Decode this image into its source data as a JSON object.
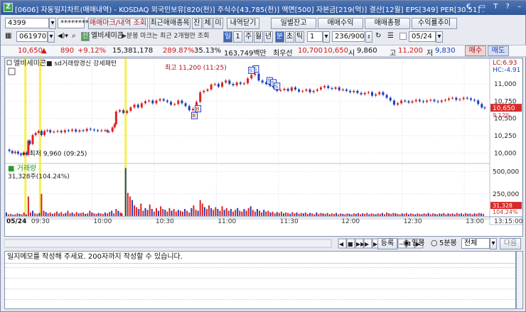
{
  "window": {
    "icon": "Z",
    "title": "[0606] 자동일지차트(매매내역) - KOSDAQ 외국인보유[820(천)] 주식수[43,785(천)] 액면[500] 자본금[219(억)] 결산[12월] EPS[349] PER[30.51] .",
    "controls": "€ ▭ T ? –"
  },
  "toolbar1": {
    "account": "4399",
    "password": "********",
    "buttons": [
      "매매마크/내역 조회",
      "최근매매종목",
      "잔",
      "체",
      "미",
      "내역닫기"
    ],
    "right_buttons": [
      "일별잔고",
      "매매수익",
      "매매총평",
      "수익률추이"
    ]
  },
  "toolbar2": {
    "code": "061970",
    "icon_label": "신",
    "stock_name": "엘비세미콘",
    "note": "▶분봉 마크는 최근 2개월만 조회",
    "period_tabs": [
      "일",
      "1",
      "주",
      "월",
      "년",
      "분",
      "초",
      "틱"
    ],
    "interval": "1",
    "count": "236/900",
    "date": "05/24"
  },
  "quote": {
    "price": "10,650",
    "change_arrow": "▲",
    "change": "890",
    "change_pct": "+9.12%",
    "volume": "15,381,178",
    "vol_ratio": "289.87%",
    "turnover": "35.13%",
    "amount": "163,749백만",
    "best_ask_label": "최우선",
    "best_ask": "10,700",
    "best_bid": "10,650",
    "open_label": "시",
    "open": "9,860",
    "high_label": "고",
    "high": "11,200",
    "low_label": "저",
    "low": "9,830",
    "buy_button": "매수",
    "sell_button": "매도"
  },
  "chart_data": {
    "type": "line",
    "legend": [
      "엘비세미콘",
      "sd거래량경신 강세패턴"
    ],
    "max_annotation": "최고 11,200 (11:25)",
    "min_annotation": "최저 9,960 (09:25)",
    "price_axis": [
      "11,000",
      "10,750",
      "10,500",
      "10,250",
      "10,000"
    ],
    "price_ylim": [
      9870,
      11330
    ],
    "hc_lc": [
      "LC:6.93",
      "HC:-4.91"
    ],
    "current_label": "10,650",
    "current_pct": "9.12%",
    "volume_label": "거래량",
    "volume_value": "31,328주(104.24%)",
    "volume_axis": [
      "500,000",
      "250,000"
    ],
    "volume_ylim": [
      0,
      560000
    ],
    "volume_current": "31,328",
    "volume_current_pct": "104.24%",
    "x_labels": [
      "05/24",
      "09:30",
      "10:00",
      "10:30",
      "11:00",
      "11:30",
      "12:00",
      "12:30",
      "13:00",
      "13:15:00"
    ],
    "price_series": [
      [
        0,
        10050
      ],
      [
        4,
        10030
      ],
      [
        8,
        10000
      ],
      [
        12,
        10020
      ],
      [
        16,
        9990
      ],
      [
        20,
        9970
      ],
      [
        24,
        10010
      ],
      [
        28,
        9975
      ],
      [
        30,
        10180
      ],
      [
        32,
        10130
      ],
      [
        36,
        10260
      ],
      [
        40,
        10290
      ],
      [
        44,
        10320
      ],
      [
        48,
        10260
      ],
      [
        52,
        10320
      ],
      [
        56,
        10330
      ],
      [
        60,
        10300
      ],
      [
        65,
        10310
      ],
      [
        70,
        10320
      ],
      [
        75,
        10300
      ],
      [
        80,
        10330
      ],
      [
        85,
        10320
      ],
      [
        90,
        10340
      ],
      [
        95,
        10310
      ],
      [
        100,
        10330
      ],
      [
        105,
        10320
      ],
      [
        110,
        10350
      ],
      [
        115,
        10340
      ],
      [
        120,
        10330
      ],
      [
        125,
        10320
      ],
      [
        130,
        10330
      ],
      [
        135,
        10330
      ],
      [
        138,
        10310
      ],
      [
        140,
        10310
      ],
      [
        145,
        10370
      ],
      [
        148,
        10420
      ],
      [
        150,
        10600
      ],
      [
        155,
        10620
      ],
      [
        160,
        10580
      ],
      [
        165,
        10610
      ],
      [
        170,
        10660
      ],
      [
        175,
        10700
      ],
      [
        180,
        10660
      ],
      [
        185,
        10720
      ],
      [
        190,
        10750
      ],
      [
        195,
        10760
      ],
      [
        200,
        10720
      ],
      [
        205,
        10760
      ],
      [
        210,
        10780
      ],
      [
        215,
        10760
      ],
      [
        220,
        10740
      ],
      [
        225,
        10700
      ],
      [
        230,
        10710
      ],
      [
        235,
        10760
      ],
      [
        240,
        10720
      ],
      [
        245,
        10680
      ],
      [
        250,
        10620
      ],
      [
        255,
        10640
      ],
      [
        260,
        10740
      ],
      [
        265,
        10880
      ],
      [
        270,
        10900
      ],
      [
        275,
        10920
      ],
      [
        280,
        10990
      ],
      [
        285,
        11000
      ],
      [
        290,
        10960
      ],
      [
        295,
        11020
      ],
      [
        300,
        11050
      ],
      [
        305,
        11000
      ],
      [
        310,
        10980
      ],
      [
        315,
        11020
      ],
      [
        320,
        11000
      ],
      [
        325,
        11010
      ],
      [
        330,
        11080
      ],
      [
        335,
        11130
      ],
      [
        340,
        11150
      ],
      [
        345,
        11050
      ],
      [
        350,
        11020
      ],
      [
        355,
        11000
      ],
      [
        360,
        10980
      ],
      [
        365,
        10950
      ],
      [
        370,
        10900
      ],
      [
        375,
        10910
      ],
      [
        380,
        10930
      ],
      [
        385,
        10900
      ],
      [
        390,
        10950
      ],
      [
        395,
        10920
      ],
      [
        400,
        10890
      ],
      [
        405,
        10900
      ],
      [
        410,
        10920
      ],
      [
        415,
        10880
      ],
      [
        420,
        10900
      ],
      [
        425,
        10920
      ],
      [
        430,
        10950
      ],
      [
        435,
        10970
      ],
      [
        440,
        10940
      ],
      [
        445,
        10930
      ],
      [
        450,
        10950
      ],
      [
        455,
        10910
      ],
      [
        460,
        10920
      ],
      [
        465,
        10900
      ],
      [
        470,
        10880
      ],
      [
        475,
        10900
      ],
      [
        480,
        10870
      ],
      [
        485,
        10850
      ],
      [
        490,
        10870
      ],
      [
        495,
        10880
      ],
      [
        500,
        10830
      ],
      [
        505,
        10850
      ],
      [
        510,
        10880
      ],
      [
        515,
        10840
      ],
      [
        520,
        10800
      ],
      [
        525,
        10760
      ],
      [
        530,
        10700
      ],
      [
        535,
        10720
      ],
      [
        540,
        10760
      ],
      [
        545,
        10750
      ],
      [
        550,
        10730
      ],
      [
        555,
        10750
      ],
      [
        560,
        10770
      ],
      [
        565,
        10750
      ],
      [
        570,
        10740
      ],
      [
        575,
        10760
      ],
      [
        580,
        10770
      ],
      [
        585,
        10750
      ],
      [
        590,
        10740
      ],
      [
        595,
        10760
      ],
      [
        600,
        10770
      ],
      [
        605,
        10790
      ],
      [
        610,
        10800
      ],
      [
        615,
        10770
      ],
      [
        620,
        10780
      ],
      [
        625,
        10800
      ],
      [
        630,
        10790
      ],
      [
        635,
        10770
      ],
      [
        640,
        10760
      ],
      [
        645,
        10710
      ],
      [
        650,
        10660
      ],
      [
        654,
        10650
      ]
    ],
    "volume_series": [
      [
        0,
        40000
      ],
      [
        3,
        20000
      ],
      [
        6,
        25000
      ],
      [
        9,
        15000
      ],
      [
        12,
        20000
      ],
      [
        15,
        30000
      ],
      [
        18,
        25000
      ],
      [
        21,
        20000
      ],
      [
        24,
        40000
      ],
      [
        27,
        20000
      ],
      [
        30,
        220000
      ],
      [
        33,
        40000
      ],
      [
        36,
        60000
      ],
      [
        39,
        30000
      ],
      [
        42,
        25000
      ],
      [
        45,
        35000
      ],
      [
        48,
        250000
      ],
      [
        51,
        60000
      ],
      [
        54,
        45000
      ],
      [
        57,
        30000
      ],
      [
        60,
        40000
      ],
      [
        63,
        25000
      ],
      [
        66,
        35000
      ],
      [
        69,
        50000
      ],
      [
        72,
        30000
      ],
      [
        75,
        45000
      ],
      [
        78,
        25000
      ],
      [
        81,
        35000
      ],
      [
        84,
        60000
      ],
      [
        87,
        30000
      ],
      [
        90,
        40000
      ],
      [
        93,
        25000
      ],
      [
        96,
        45000
      ],
      [
        99,
        30000
      ],
      [
        102,
        35000
      ],
      [
        105,
        40000
      ],
      [
        108,
        25000
      ],
      [
        111,
        30000
      ],
      [
        114,
        60000
      ],
      [
        117,
        40000
      ],
      [
        120,
        30000
      ],
      [
        123,
        25000
      ],
      [
        126,
        35000
      ],
      [
        129,
        30000
      ],
      [
        132,
        25000
      ],
      [
        135,
        40000
      ],
      [
        138,
        30000
      ],
      [
        141,
        45000
      ],
      [
        144,
        60000
      ],
      [
        147,
        30000
      ],
      [
        150,
        80000
      ],
      [
        153,
        60000
      ],
      [
        156,
        40000
      ],
      [
        158,
        30000
      ],
      [
        163,
        540000
      ],
      [
        166,
        260000
      ],
      [
        169,
        220000
      ],
      [
        172,
        180000
      ],
      [
        175,
        120000
      ],
      [
        178,
        100000
      ],
      [
        181,
        80000
      ],
      [
        184,
        140000
      ],
      [
        187,
        60000
      ],
      [
        190,
        90000
      ],
      [
        193,
        70000
      ],
      [
        196,
        130000
      ],
      [
        199,
        80000
      ],
      [
        202,
        50000
      ],
      [
        205,
        90000
      ],
      [
        208,
        60000
      ],
      [
        211,
        110000
      ],
      [
        214,
        80000
      ],
      [
        217,
        70000
      ],
      [
        220,
        50000
      ],
      [
        223,
        90000
      ],
      [
        226,
        60000
      ],
      [
        229,
        80000
      ],
      [
        232,
        50000
      ],
      [
        235,
        70000
      ],
      [
        238,
        60000
      ],
      [
        241,
        50000
      ],
      [
        244,
        80000
      ],
      [
        247,
        60000
      ],
      [
        250,
        40000
      ],
      [
        253,
        90000
      ],
      [
        256,
        120000
      ],
      [
        259,
        70000
      ],
      [
        262,
        60000
      ],
      [
        265,
        180000
      ],
      [
        268,
        140000
      ],
      [
        271,
        100000
      ],
      [
        274,
        80000
      ],
      [
        277,
        120000
      ],
      [
        280,
        90000
      ],
      [
        283,
        70000
      ],
      [
        286,
        100000
      ],
      [
        289,
        80000
      ],
      [
        292,
        60000
      ],
      [
        295,
        110000
      ],
      [
        298,
        70000
      ],
      [
        301,
        90000
      ],
      [
        304,
        60000
      ],
      [
        307,
        80000
      ],
      [
        310,
        50000
      ],
      [
        313,
        70000
      ],
      [
        316,
        90000
      ],
      [
        319,
        60000
      ],
      [
        322,
        50000
      ],
      [
        325,
        80000
      ],
      [
        328,
        60000
      ],
      [
        331,
        90000
      ],
      [
        334,
        110000
      ],
      [
        337,
        70000
      ],
      [
        340,
        50000
      ],
      [
        343,
        80000
      ],
      [
        346,
        60000
      ],
      [
        349,
        40000
      ],
      [
        352,
        70000
      ],
      [
        355,
        50000
      ],
      [
        358,
        60000
      ],
      [
        361,
        40000
      ],
      [
        364,
        50000
      ],
      [
        367,
        30000
      ],
      [
        370,
        45000
      ],
      [
        373,
        35000
      ],
      [
        376,
        50000
      ],
      [
        379,
        30000
      ],
      [
        382,
        40000
      ],
      [
        385,
        35000
      ],
      [
        388,
        25000
      ],
      [
        391,
        45000
      ],
      [
        394,
        30000
      ],
      [
        397,
        40000
      ],
      [
        400,
        25000
      ],
      [
        403,
        35000
      ],
      [
        406,
        30000
      ],
      [
        409,
        40000
      ],
      [
        412,
        25000
      ],
      [
        415,
        35000
      ],
      [
        418,
        30000
      ],
      [
        421,
        20000
      ],
      [
        424,
        40000
      ],
      [
        427,
        25000
      ],
      [
        430,
        35000
      ],
      [
        433,
        30000
      ],
      [
        436,
        25000
      ],
      [
        439,
        35000
      ],
      [
        442,
        20000
      ],
      [
        445,
        30000
      ],
      [
        448,
        25000
      ],
      [
        451,
        35000
      ],
      [
        454,
        20000
      ],
      [
        457,
        30000
      ],
      [
        460,
        25000
      ],
      [
        463,
        20000
      ],
      [
        466,
        30000
      ],
      [
        469,
        25000
      ],
      [
        472,
        20000
      ],
      [
        475,
        30000
      ],
      [
        478,
        25000
      ],
      [
        481,
        35000
      ],
      [
        484,
        20000
      ],
      [
        487,
        30000
      ],
      [
        490,
        25000
      ],
      [
        493,
        35000
      ],
      [
        496,
        20000
      ],
      [
        499,
        30000
      ],
      [
        502,
        25000
      ],
      [
        505,
        20000
      ],
      [
        508,
        30000
      ],
      [
        511,
        25000
      ],
      [
        514,
        35000
      ],
      [
        517,
        20000
      ],
      [
        520,
        40000
      ],
      [
        523,
        30000
      ],
      [
        526,
        25000
      ],
      [
        529,
        35000
      ],
      [
        532,
        30000
      ],
      [
        535,
        25000
      ],
      [
        538,
        20000
      ],
      [
        541,
        30000
      ],
      [
        544,
        25000
      ],
      [
        547,
        35000
      ],
      [
        550,
        20000
      ],
      [
        553,
        30000
      ],
      [
        556,
        25000
      ],
      [
        559,
        20000
      ],
      [
        562,
        30000
      ],
      [
        565,
        25000
      ],
      [
        568,
        20000
      ],
      [
        571,
        30000
      ],
      [
        574,
        25000
      ],
      [
        577,
        35000
      ],
      [
        580,
        20000
      ],
      [
        583,
        30000
      ],
      [
        586,
        25000
      ],
      [
        589,
        20000
      ],
      [
        592,
        30000
      ],
      [
        595,
        25000
      ],
      [
        598,
        35000
      ],
      [
        601,
        20000
      ],
      [
        604,
        30000
      ],
      [
        607,
        25000
      ],
      [
        610,
        30000
      ],
      [
        613,
        20000
      ],
      [
        616,
        35000
      ],
      [
        619,
        25000
      ],
      [
        622,
        30000
      ],
      [
        625,
        20000
      ],
      [
        628,
        35000
      ],
      [
        631,
        25000
      ],
      [
        634,
        30000
      ],
      [
        637,
        20000
      ],
      [
        640,
        30000
      ],
      [
        643,
        25000
      ],
      [
        646,
        35000
      ],
      [
        649,
        30000
      ],
      [
        652,
        25000
      ]
    ]
  },
  "chart_controls": [
    "◀",
    "■",
    "▶▶",
    "▶",
    "▶▶",
    "⇔",
    "+",
    "−",
    "↕",
    "▶"
  ],
  "memo": {
    "placeholder": "일지메모를 작성해 주세요. 200자까지 작성할 수 있습니다.",
    "register_button": "등록",
    "radio_daily": "일봉",
    "radio_5min": "5분봉",
    "filter_value": "전체",
    "next_button": "다음"
  }
}
